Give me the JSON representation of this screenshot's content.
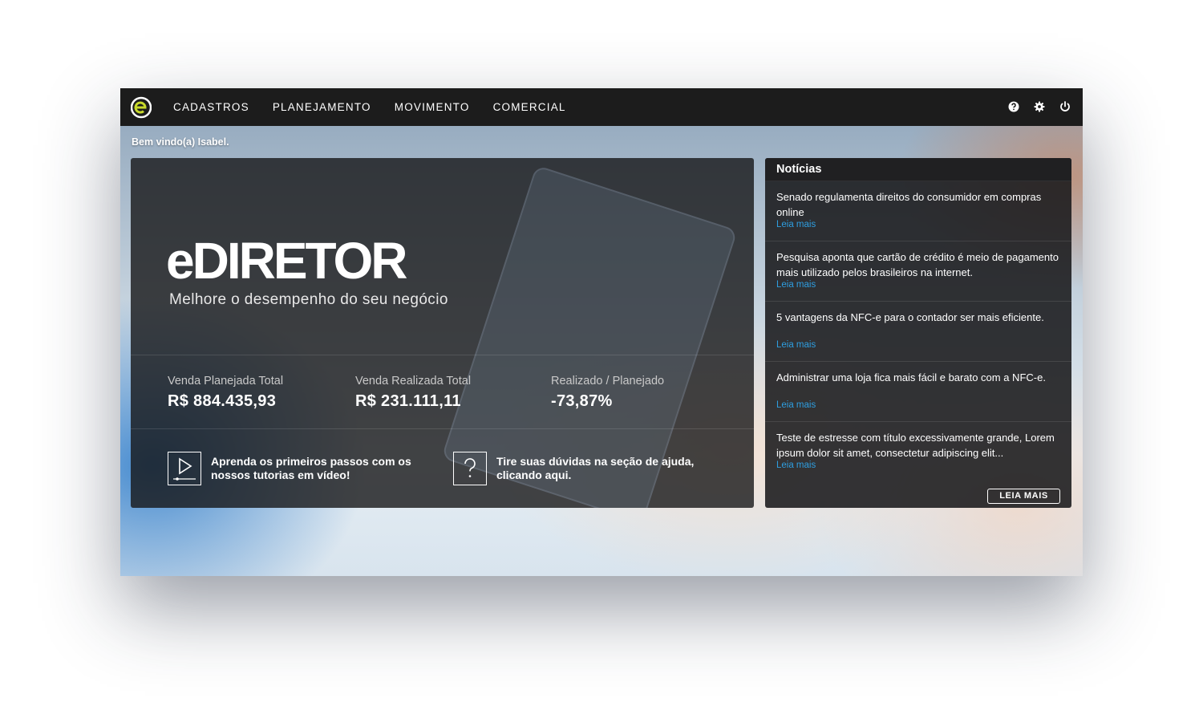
{
  "app": {
    "logo_icon": "edireto-logo-icon",
    "brand_colors": {
      "logo_accent": "#c7d82b",
      "link": "#2e9ee0",
      "topbar": "#1c1c1c"
    }
  },
  "nav": {
    "items": [
      {
        "label": "CADASTROS"
      },
      {
        "label": "PLANEJAMENTO"
      },
      {
        "label": "MOVIMENTO"
      },
      {
        "label": "COMERCIAL"
      }
    ],
    "icons": [
      "help-icon",
      "gear-icon",
      "power-icon"
    ]
  },
  "welcome": "Bem vindo(a) Isabel.",
  "hero": {
    "brand": "eDIRETOR",
    "tagline": "Melhore o desempenho do seu negócio",
    "stats": [
      {
        "label": "Venda Planejada Total",
        "value": "R$ 884.435,93"
      },
      {
        "label": "Venda Realizada Total",
        "value": "R$ 231.111,11"
      },
      {
        "label": "Realizado / Planejado",
        "value": "-73,87%"
      }
    ],
    "help": [
      {
        "icon": "video-play-icon",
        "line1": "Aprenda os primeiros passos com os",
        "line2": "nossos tutorias em vídeo!"
      },
      {
        "icon": "question-mark-icon",
        "line1": "Tire suas dúvidas na seção de ajuda,",
        "line2": "clicando aqui."
      }
    ]
  },
  "news": {
    "title": "Notícias",
    "items": [
      {
        "title": "Senado regulamenta direitos do consumidor em compras online",
        "link": "Leia mais"
      },
      {
        "title": "Pesquisa aponta que cartão de crédito é meio de pagamento mais utilizado pelos brasileiros na internet.",
        "link": "Leia mais"
      },
      {
        "title": "5 vantagens da NFC-e para o contador ser mais eficiente.",
        "link": "Leia mais"
      },
      {
        "title": "Administrar uma loja fica mais fácil e barato com a NFC-e.",
        "link": "Leia mais"
      },
      {
        "title": "Teste de estresse com título excessivamente grande, Lorem ipsum dolor sit amet, consectetur adipiscing elit...",
        "link": "Leia mais"
      }
    ],
    "button_label": "LEIA MAIS"
  }
}
